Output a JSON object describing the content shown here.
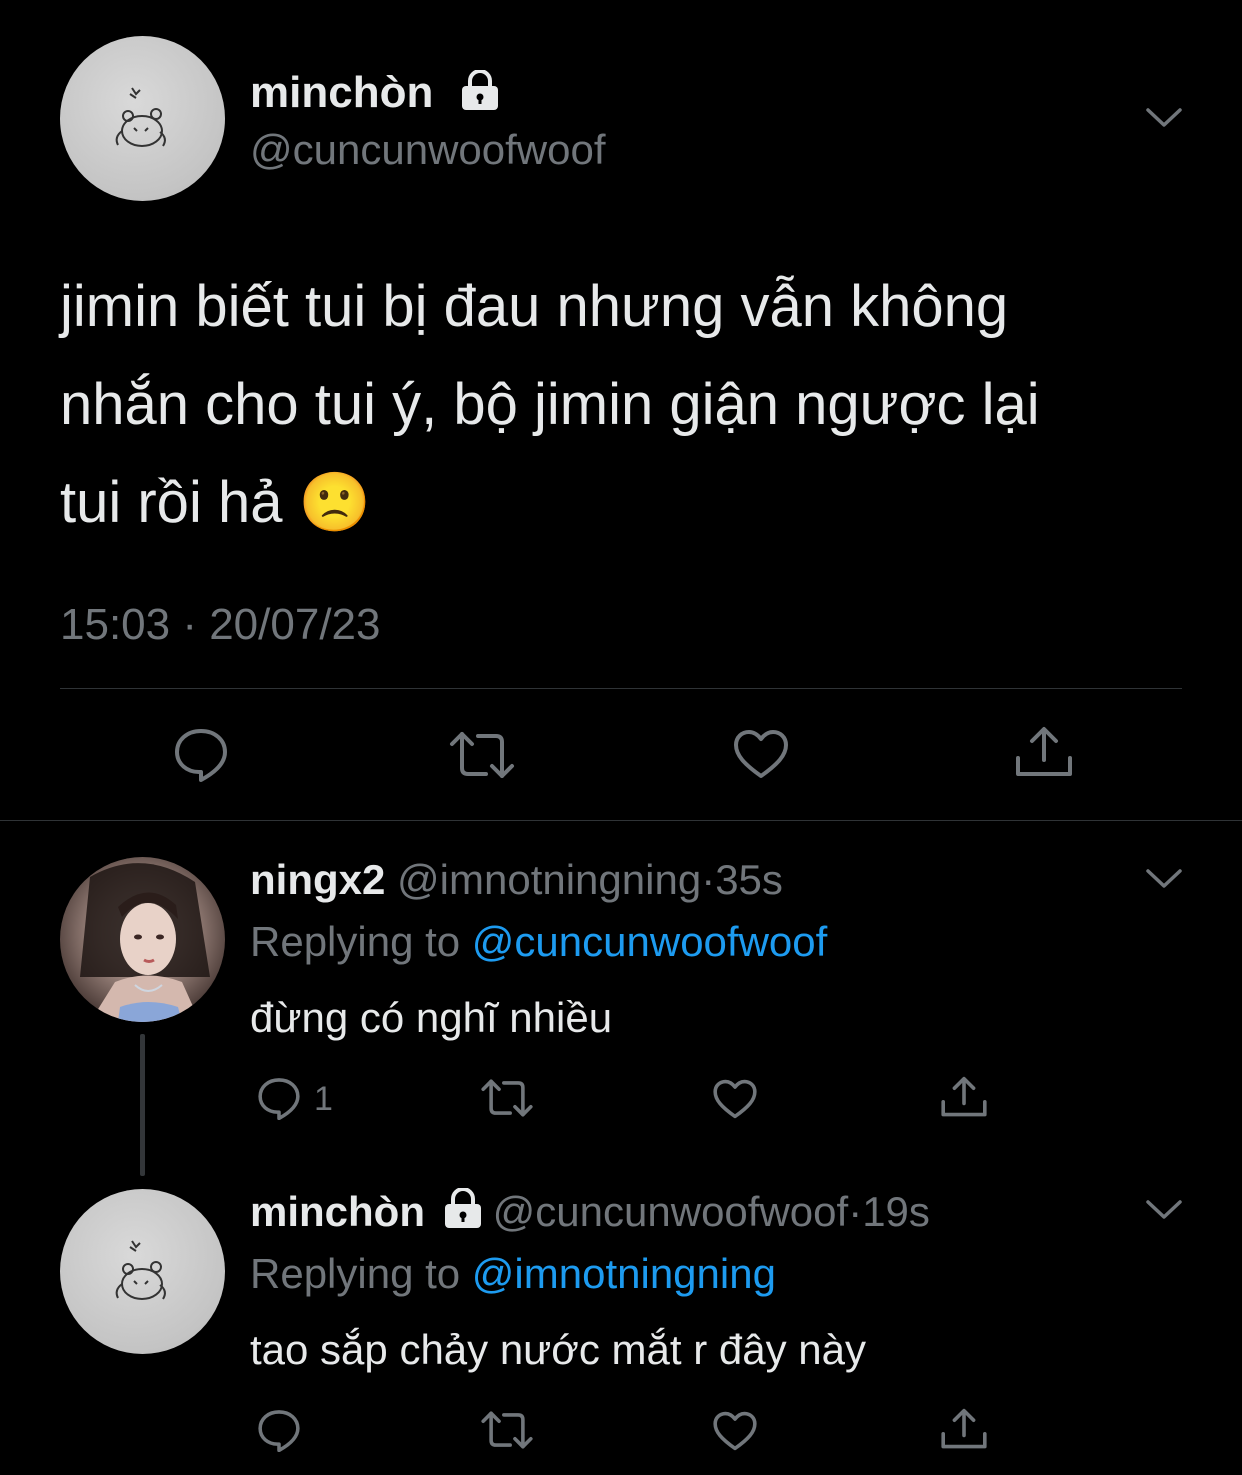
{
  "main_tweet": {
    "display_name": "minchòn",
    "handle": "@cuncunwoofwoof",
    "text_line1": "jimin biết tui bị đau nhưng vẫn không",
    "text_line2": "nhắn cho tui ý, bộ jimin giận ngược lại",
    "text_line3": "tui rồi hả 🙁",
    "timestamp": "15:03 · 20/07/23"
  },
  "reply1": {
    "display_name": "ningx2",
    "handle": "@imnotningning",
    "sep": "·",
    "time": "35s",
    "replying_prefix": "Replying to ",
    "replying_to": "@cuncunwoofwoof",
    "text": "đừng có nghĩ nhiều",
    "reply_count": "1"
  },
  "reply2": {
    "display_name": "minchòn",
    "handle": "@cuncunwoofwoof",
    "sep": "·",
    "time": "19s",
    "replying_prefix": "Replying to ",
    "replying_to": "@imnotningning",
    "text": "tao sắp chảy nước mắt r đây này"
  },
  "colors": {
    "background": "#000000",
    "text": "#e7e9ea",
    "secondary": "#71767b",
    "link": "#1d9bf0",
    "divider": "#2f3336"
  },
  "icons": [
    "lock-icon",
    "chevron-down-icon",
    "reply-icon",
    "retweet-icon",
    "like-icon",
    "share-icon"
  ]
}
